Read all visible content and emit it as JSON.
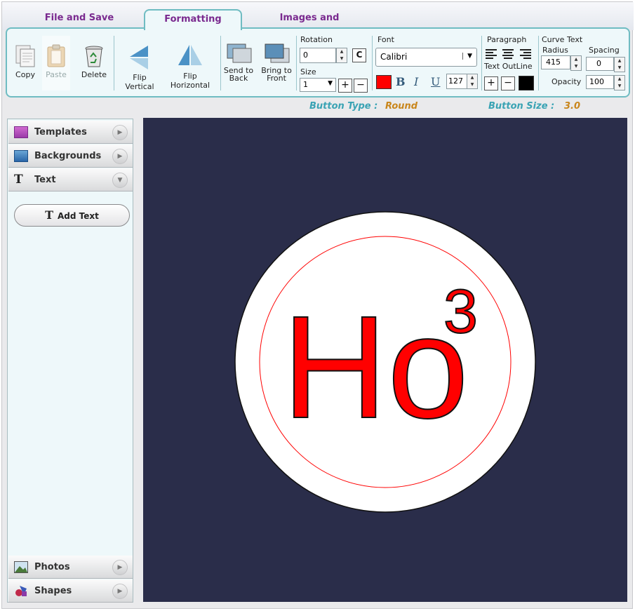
{
  "tabs": [
    {
      "label": "File and Save"
    },
    {
      "label": "Formatting"
    },
    {
      "label": "Images and Shapes"
    }
  ],
  "toolbar": {
    "copy": "Copy",
    "paste": "Paste",
    "delete": "Delete",
    "flip_vertical": "Flip Vertical",
    "flip_horizontal": "Flip Horizontal",
    "send_to_back_line1": "Send to",
    "send_to_back_line2": "Back",
    "bring_to_front_line1": "Bring to",
    "bring_to_front_line2": "Front",
    "rotation_label": "Rotation",
    "rotation_value": "0",
    "rotation_clear": "C",
    "size_label": "Size",
    "size_value": "1",
    "font_label": "Font",
    "font_value": "Calibri",
    "font_size_value": "127",
    "paragraph_label": "Paragraph",
    "text_outline_label": "Text OutLine",
    "curve_text_label": "Curve Text",
    "radius_label": "Radius",
    "radius_value": "415",
    "spacing_label": "Spacing",
    "spacing_value": "0",
    "opacity_label": "Opacity",
    "opacity_value": "100"
  },
  "info": {
    "button_type_label": "Button Type :",
    "button_type_value": "Round",
    "button_size_label": "Button Size :",
    "button_size_value": "3.0"
  },
  "sidebar": {
    "sections": [
      {
        "label": "Templates"
      },
      {
        "label": "Backgrounds"
      },
      {
        "label": "Text"
      },
      {
        "label": "Photos"
      },
      {
        "label": "Shapes"
      }
    ],
    "add_text": "Add Text"
  },
  "canvas": {
    "main_text": "Ho",
    "superscript": "3"
  },
  "colors": {
    "accent_purple": "#7a2a8f",
    "teal": "#3aa3b4",
    "orange": "#c9861c",
    "canvas_bg": "#2a2d4a",
    "text_red": "#ff0000"
  }
}
